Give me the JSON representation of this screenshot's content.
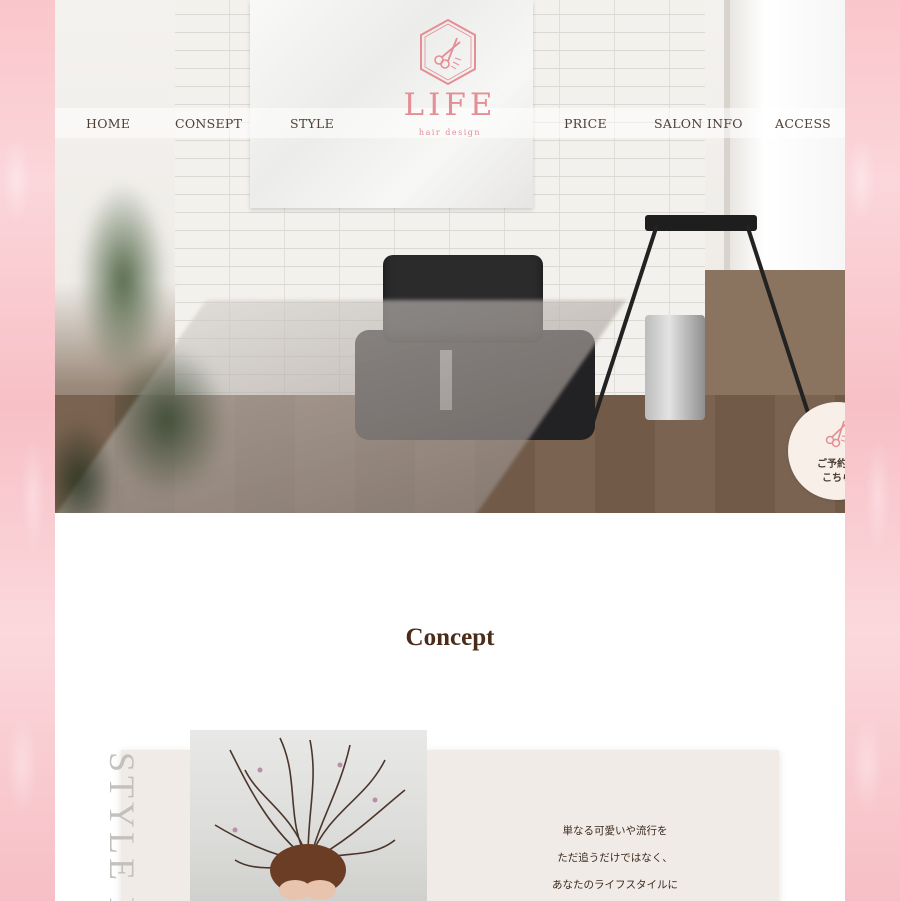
{
  "nav": {
    "home": "HOME",
    "consept": "CONSEPT",
    "style": "STYLE",
    "price": "PRICE",
    "salon_info": "SALON INFO",
    "access": "ACCESS"
  },
  "logo": {
    "title": "LIFE",
    "subtitle": "hair design",
    "icon": "scissors-hexagon-icon"
  },
  "reserve_button": {
    "line1": "ご予約は",
    "line2": "こちら",
    "icon": "scissors-icon"
  },
  "concept": {
    "title": "Concept",
    "vertical_text": "STYLE FIT",
    "lines": [
      "単なる可愛いや流行を",
      "ただ追うだけではなく、",
      "あなたのライフスタイルに"
    ]
  },
  "colors": {
    "brand_pink": "#e48e96",
    "side_pink": "#fbd9dd",
    "title_brown": "#4a2c18",
    "card_beige": "#f0ebe6"
  }
}
